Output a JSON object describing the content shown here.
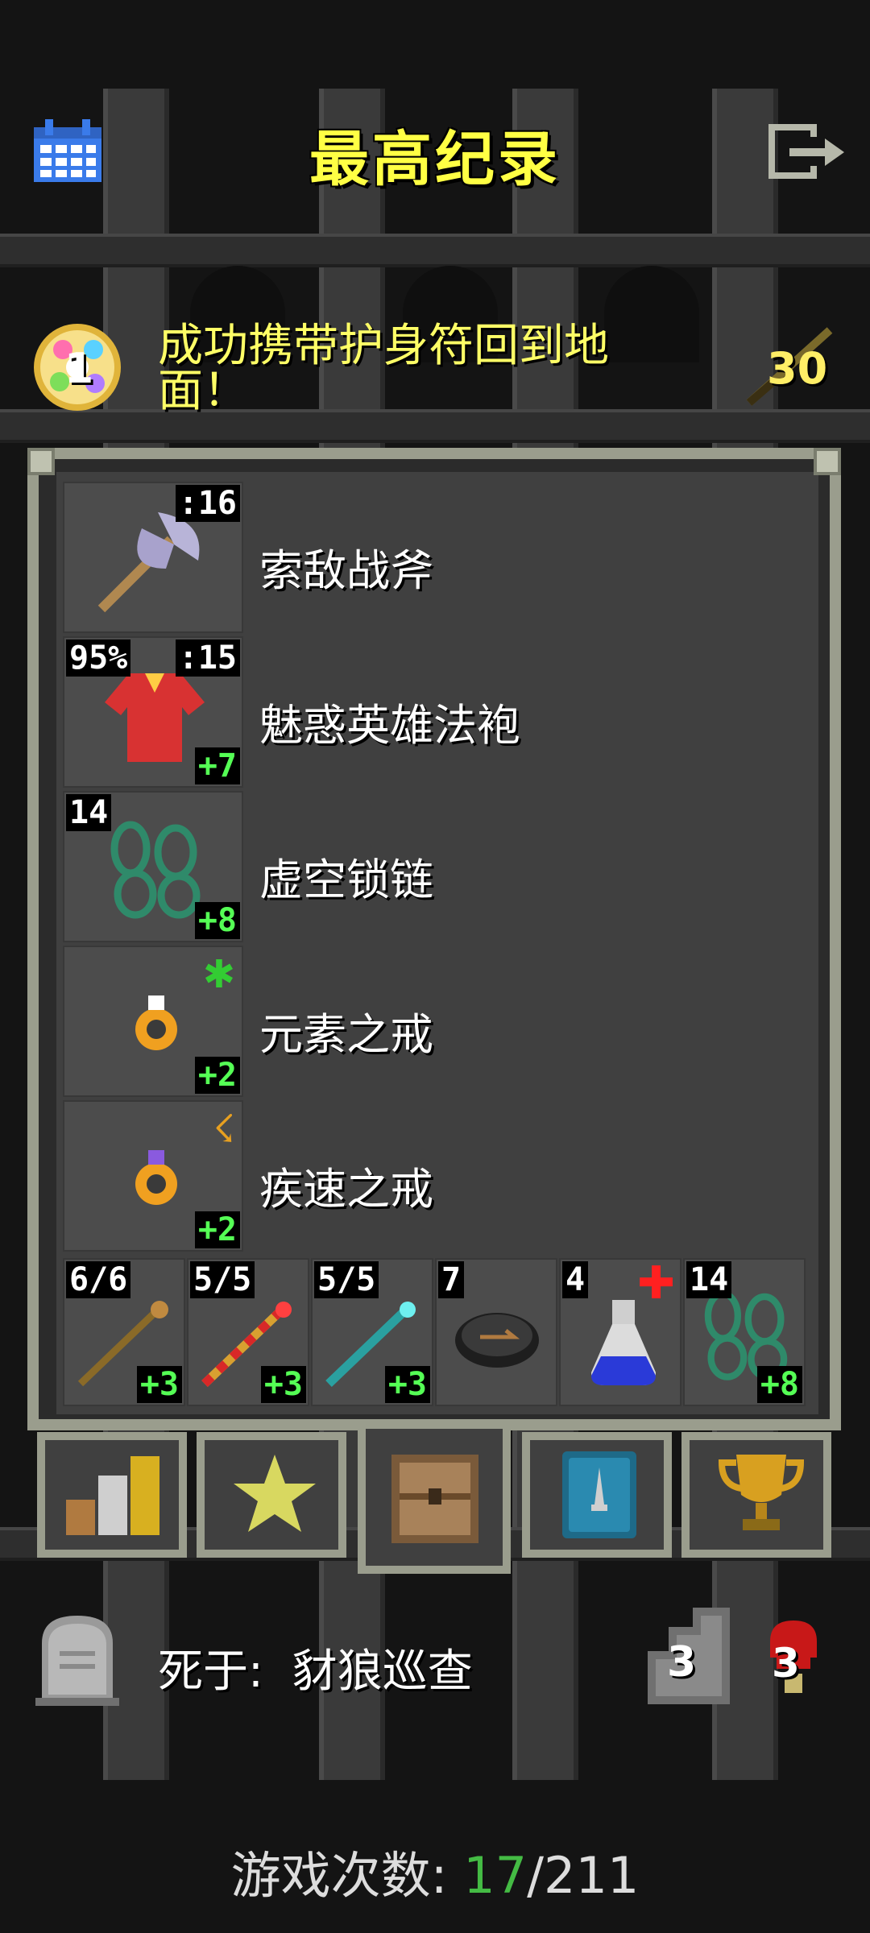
{
  "header": {
    "title": "最高纪录",
    "calendar_icon": "calendar-icon",
    "exit_icon": "exit-icon"
  },
  "record": {
    "amulet_icon": "amulet-icon",
    "amulet_count": "1",
    "description": "成功携带护身符回到地面！",
    "level": "30"
  },
  "inventory": {
    "items": [
      {
        "name": "索敌战斧",
        "icon": "battle-axe-icon",
        "top_right": ":16"
      },
      {
        "name": "魅惑英雄法袍",
        "icon": "robe-icon",
        "top_left": "95%",
        "top_right": ":15",
        "bottom_right": "+7"
      },
      {
        "name": "虚空锁链",
        "icon": "chain-icon",
        "top_left": "14",
        "bottom_right": "+8"
      },
      {
        "name": "元素之戒",
        "icon": "ring-element-icon",
        "top_right_symbol": "✱",
        "bottom_right": "+2"
      },
      {
        "name": "疾速之戒",
        "icon": "ring-haste-icon",
        "top_right_symbol": "☇",
        "bottom_right": "+2"
      }
    ],
    "quickslots": [
      {
        "icon": "staff-brown-icon",
        "top_left": "6/6",
        "bottom_right": "+3"
      },
      {
        "icon": "staff-fire-icon",
        "top_left": "5/5",
        "bottom_right": "+3"
      },
      {
        "icon": "staff-frost-icon",
        "top_left": "5/5",
        "bottom_right": "+3"
      },
      {
        "icon": "stone-icon",
        "top_left": "7"
      },
      {
        "icon": "potion-healing-icon",
        "top_left": "4",
        "top_right_symbol": "✚"
      },
      {
        "icon": "chain-icon",
        "top_left": "14",
        "bottom_right": "+8"
      }
    ]
  },
  "tabs": [
    {
      "icon": "stats-icon"
    },
    {
      "icon": "star-icon"
    },
    {
      "icon": "backpack-icon"
    },
    {
      "icon": "badge-icon"
    },
    {
      "icon": "trophy-icon"
    }
  ],
  "bottom": {
    "died_label": "死于:",
    "died_cause": "豺狼巡查",
    "depth": "3",
    "kills": "3",
    "games_label": "游戏次数:",
    "games_current": "17",
    "games_total": "/211"
  },
  "colors": {
    "title": "#ffff44",
    "record_text": "#ffff66",
    "plus_green": "#55ff55",
    "games_current": "#44bb44"
  }
}
